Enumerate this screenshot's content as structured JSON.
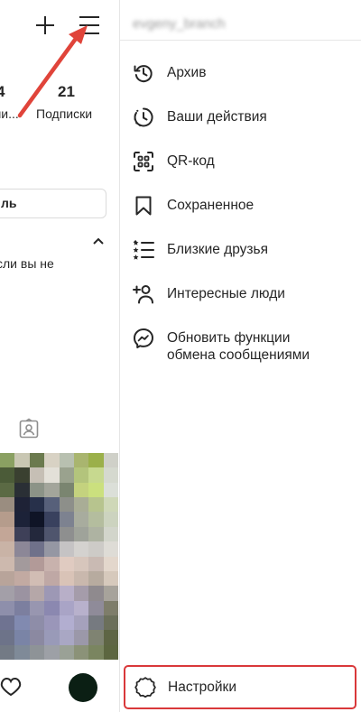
{
  "profile": {
    "stats": [
      {
        "value": "4",
        "label": "чи..."
      },
      {
        "value": "21",
        "label": "Подписки"
      }
    ],
    "edit_button_label": "ль",
    "hint_text": "сли вы не"
  },
  "drawer": {
    "username": "evgeny_branch",
    "items": [
      {
        "label": "Архив",
        "icon": "archive-icon"
      },
      {
        "label": "Ваши действия",
        "icon": "activity-icon"
      },
      {
        "label": "QR-код",
        "icon": "qr-code-icon"
      },
      {
        "label": "Сохраненное",
        "icon": "bookmark-icon"
      },
      {
        "label": "Близкие друзья",
        "icon": "close-friends-icon"
      },
      {
        "label": "Интересные люди",
        "icon": "add-person-icon"
      },
      {
        "label": "Обновить функции обмена сообщениями",
        "icon": "messenger-icon"
      }
    ],
    "settings_label": "Настройки"
  },
  "colors": {
    "highlight": "#d9383a",
    "arrow": "#e0443a"
  }
}
